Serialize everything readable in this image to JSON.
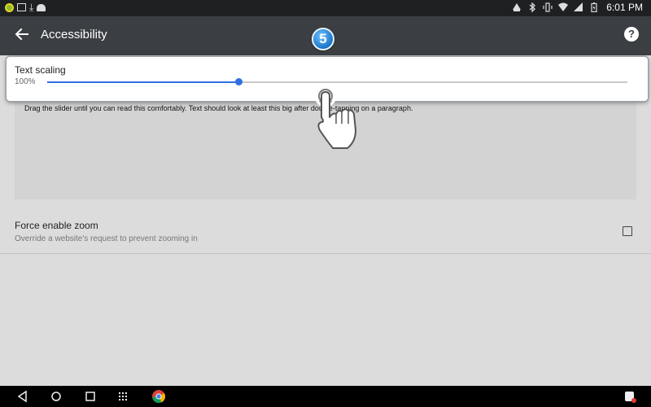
{
  "status_bar": {
    "time": "6:01 PM",
    "left_icons": [
      "chrome-notification-icon",
      "image-icon",
      "download-icon",
      "android-icon"
    ],
    "right_icons": [
      "notification-icon",
      "bluetooth-icon",
      "vibrate-icon",
      "wifi-icon",
      "signal-icon",
      "battery-icon"
    ]
  },
  "app_bar": {
    "title": "Accessibility",
    "back_icon": "arrow-left-icon",
    "help_icon": "help-icon",
    "help_glyph": "?"
  },
  "step_badge": "5",
  "text_scaling": {
    "title": "Text scaling",
    "value": "100%",
    "slider_fraction": 0.33
  },
  "preview": {
    "text": "Drag the slider until you can read this comfortably. Text should look at least this big after double-tapping on a paragraph."
  },
  "force_zoom": {
    "title": "Force enable zoom",
    "subtitle": "Override a website's request to prevent zooming in",
    "checked": false
  },
  "nav_bar": {
    "icons": [
      "back-icon",
      "home-icon",
      "recents-icon",
      "app-drawer-icon",
      "chrome-icon",
      "notification-app-icon"
    ]
  },
  "colors": {
    "app_bar": "#3b3e42",
    "status_bar": "#1e2022",
    "accent": "#2f6fe0",
    "background": "#dcdcdc"
  }
}
